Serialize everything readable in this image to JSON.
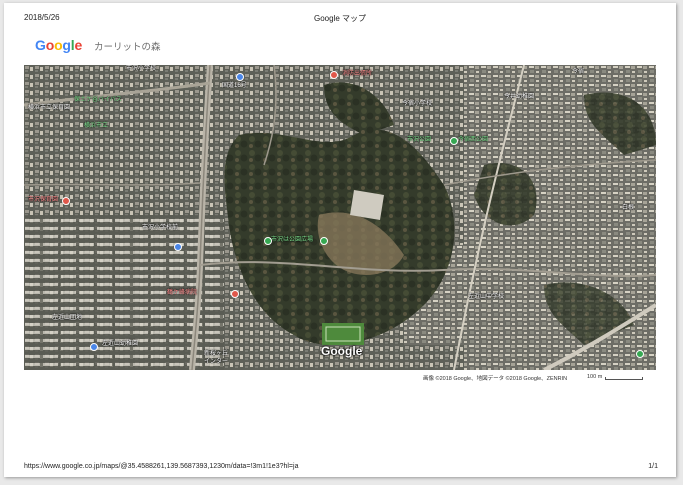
{
  "print_header": {
    "date": "2018/5/26",
    "title": "Google マップ"
  },
  "logo": {
    "letters": [
      "G",
      "o",
      "o",
      "g",
      "l",
      "e"
    ],
    "colors": [
      "#4285F4",
      "#EA4335",
      "#FBBC05",
      "#4285F4",
      "#34A853",
      "#EA4335"
    ]
  },
  "place_name": "カーリットの森",
  "map": {
    "watermark": "Google",
    "labels": [
      {
        "text": "市沢小学校",
        "color": "white"
      },
      {
        "text": "国道16号",
        "color": "white"
      },
      {
        "text": "保土ケ谷バイパス",
        "color": "green"
      },
      {
        "text": "横浜市立",
        "color": "green"
      },
      {
        "text": "市沢公園",
        "color": "green"
      },
      {
        "text": "今宿西公園",
        "color": "green"
      },
      {
        "text": "市沢は公園広場",
        "color": "green"
      },
      {
        "text": "左近山団地",
        "color": "white"
      },
      {
        "text": "左近山幼稚園",
        "color": "white"
      },
      {
        "text": "横浜市立保育園",
        "color": "white"
      },
      {
        "text": "新桜ヶ丘",
        "color": "white"
      },
      {
        "text": "インター",
        "color": "white"
      },
      {
        "text": "今宿",
        "color": "white"
      },
      {
        "text": "白根",
        "color": "white"
      },
      {
        "text": "市沢小学校前",
        "color": "white"
      },
      {
        "text": "消防出張所",
        "color": "red"
      },
      {
        "text": "今井幼稚園",
        "color": "white"
      },
      {
        "text": "今宿小学校",
        "color": "white"
      },
      {
        "text": "市沢保育園",
        "color": "red"
      },
      {
        "text": "鶴ケ峰病院",
        "color": "red"
      },
      {
        "text": "左近山中学校",
        "color": "white"
      }
    ]
  },
  "attribution": "画像 ©2018 Google、地図データ ©2018 Google、ZENRIN",
  "scale": "100 m",
  "footer": {
    "url": "https://www.google.co.jp/maps/@35.4588261,139.5687393,1230m/data=!3m1!1e3?hl=ja",
    "page": "1/1"
  }
}
